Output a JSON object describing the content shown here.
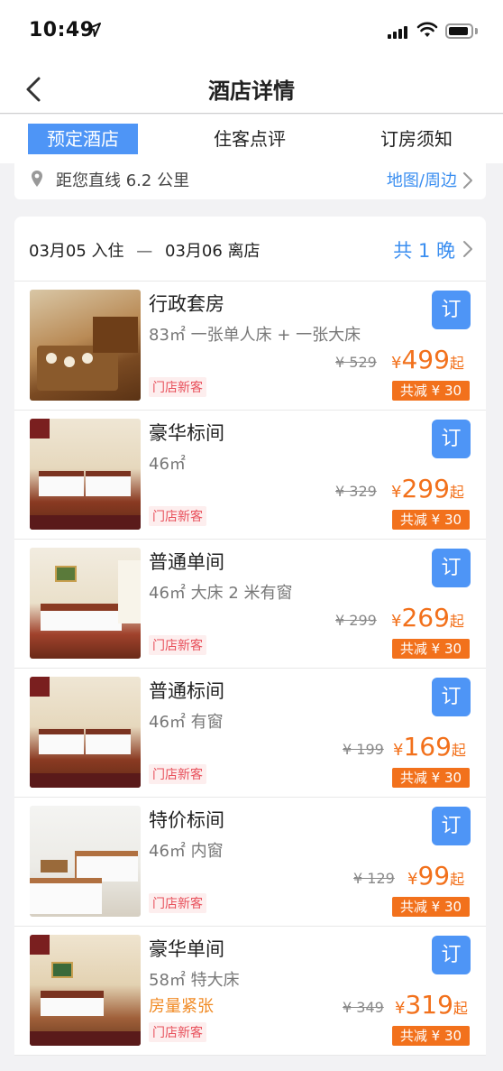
{
  "status_bar": {
    "time": "10:49"
  },
  "nav": {
    "title": "酒店详情"
  },
  "tabs": [
    {
      "label": "预定酒店",
      "active": true
    },
    {
      "label": "住客点评",
      "active": false
    },
    {
      "label": "订房须知",
      "active": false
    }
  ],
  "location": {
    "distance": "距您直线 6.2 公里",
    "map_link": "地图/周边"
  },
  "stay": {
    "checkin": "03月05 入住",
    "dash": "—",
    "checkout": "03月06 离店",
    "nights": "共 1 晚"
  },
  "rooms": [
    {
      "name": "行政套房",
      "desc": "83㎡ 一张单人床 + 一张大床",
      "alert": "",
      "tag": "门店新客",
      "book_label": "订",
      "original_price": "¥ 529",
      "currency": "¥",
      "price": "499",
      "suffix": "起",
      "discount": "共减 ¥ 30"
    },
    {
      "name": "豪华标间",
      "desc": "46㎡",
      "alert": "",
      "tag": "门店新客",
      "book_label": "订",
      "original_price": "¥ 329",
      "currency": "¥",
      "price": "299",
      "suffix": "起",
      "discount": "共减 ¥ 30"
    },
    {
      "name": "普通单间",
      "desc": "46㎡ 大床 2 米有窗",
      "alert": "",
      "tag": "门店新客",
      "book_label": "订",
      "original_price": "¥ 299",
      "currency": "¥",
      "price": "269",
      "suffix": "起",
      "discount": "共减 ¥ 30"
    },
    {
      "name": "普通标间",
      "desc": "46㎡ 有窗",
      "alert": "",
      "tag": "门店新客",
      "book_label": "订",
      "original_price": "¥ 199",
      "currency": "¥",
      "price": "169",
      "suffix": "起",
      "discount": "共减 ¥ 30"
    },
    {
      "name": "特价标间",
      "desc": "46㎡ 内窗",
      "alert": "",
      "tag": "门店新客",
      "book_label": "订",
      "original_price": "¥ 129",
      "currency": "¥",
      "price": "99",
      "suffix": "起",
      "discount": "共减 ¥ 30"
    },
    {
      "name": "豪华单间",
      "desc": "58㎡ 特大床",
      "alert": "房量紧张",
      "tag": "门店新客",
      "book_label": "订",
      "original_price": "¥ 349",
      "currency": "¥",
      "price": "319",
      "suffix": "起",
      "discount": "共减 ¥ 30"
    }
  ],
  "colors": {
    "accent_blue": "#4e95f6",
    "price_orange": "#f2711c",
    "tag_red": "#e8505b"
  }
}
